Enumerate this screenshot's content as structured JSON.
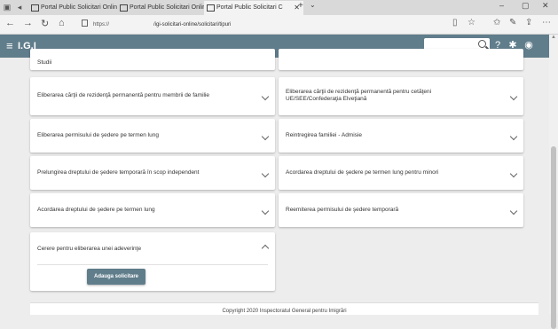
{
  "browser": {
    "tabs": [
      {
        "label": "Portal Public Solicitari Onlin"
      },
      {
        "label": "Portal Public Solicitari Onlin"
      },
      {
        "label": "Portal Public Solicitari C"
      }
    ],
    "url_scheme": "https://",
    "url_path": "/igi-solicitari-online/solicitari/tipuri"
  },
  "app": {
    "title": "I.G.I",
    "search_placeholder": ""
  },
  "cards": {
    "left": [
      {
        "label": "Studii"
      },
      {
        "label": "Eliberarea cărţii de rezidenţă permanentă pentru membrii de familie"
      },
      {
        "label": "Eliberarea permisului de şedere pe termen lung"
      },
      {
        "label": "Prelungirea dreptului de şedere temporară în scop independent"
      },
      {
        "label": "Acordarea dreptului de şedere pe termen lung"
      },
      {
        "label": "Cerere pentru eliberarea unei adeverinţe"
      }
    ],
    "right": [
      {
        "label": "Eliberarea cărţii de rezidenţă permanentă pentru cetăţeni UE/SEE/Confederaţia Elveţiană"
      },
      {
        "label": "Reintregirea familiei - Admisie"
      },
      {
        "label": "Acordarea dreptului de şedere pe termen lung pentru minori"
      },
      {
        "label": "Reemiterea permisului de şedere temporară"
      }
    ]
  },
  "actions": {
    "add_request": "Adauga solicitare"
  },
  "footer": {
    "text": "Copyright 2020 Inspectoratul General pentru Imigrări"
  }
}
